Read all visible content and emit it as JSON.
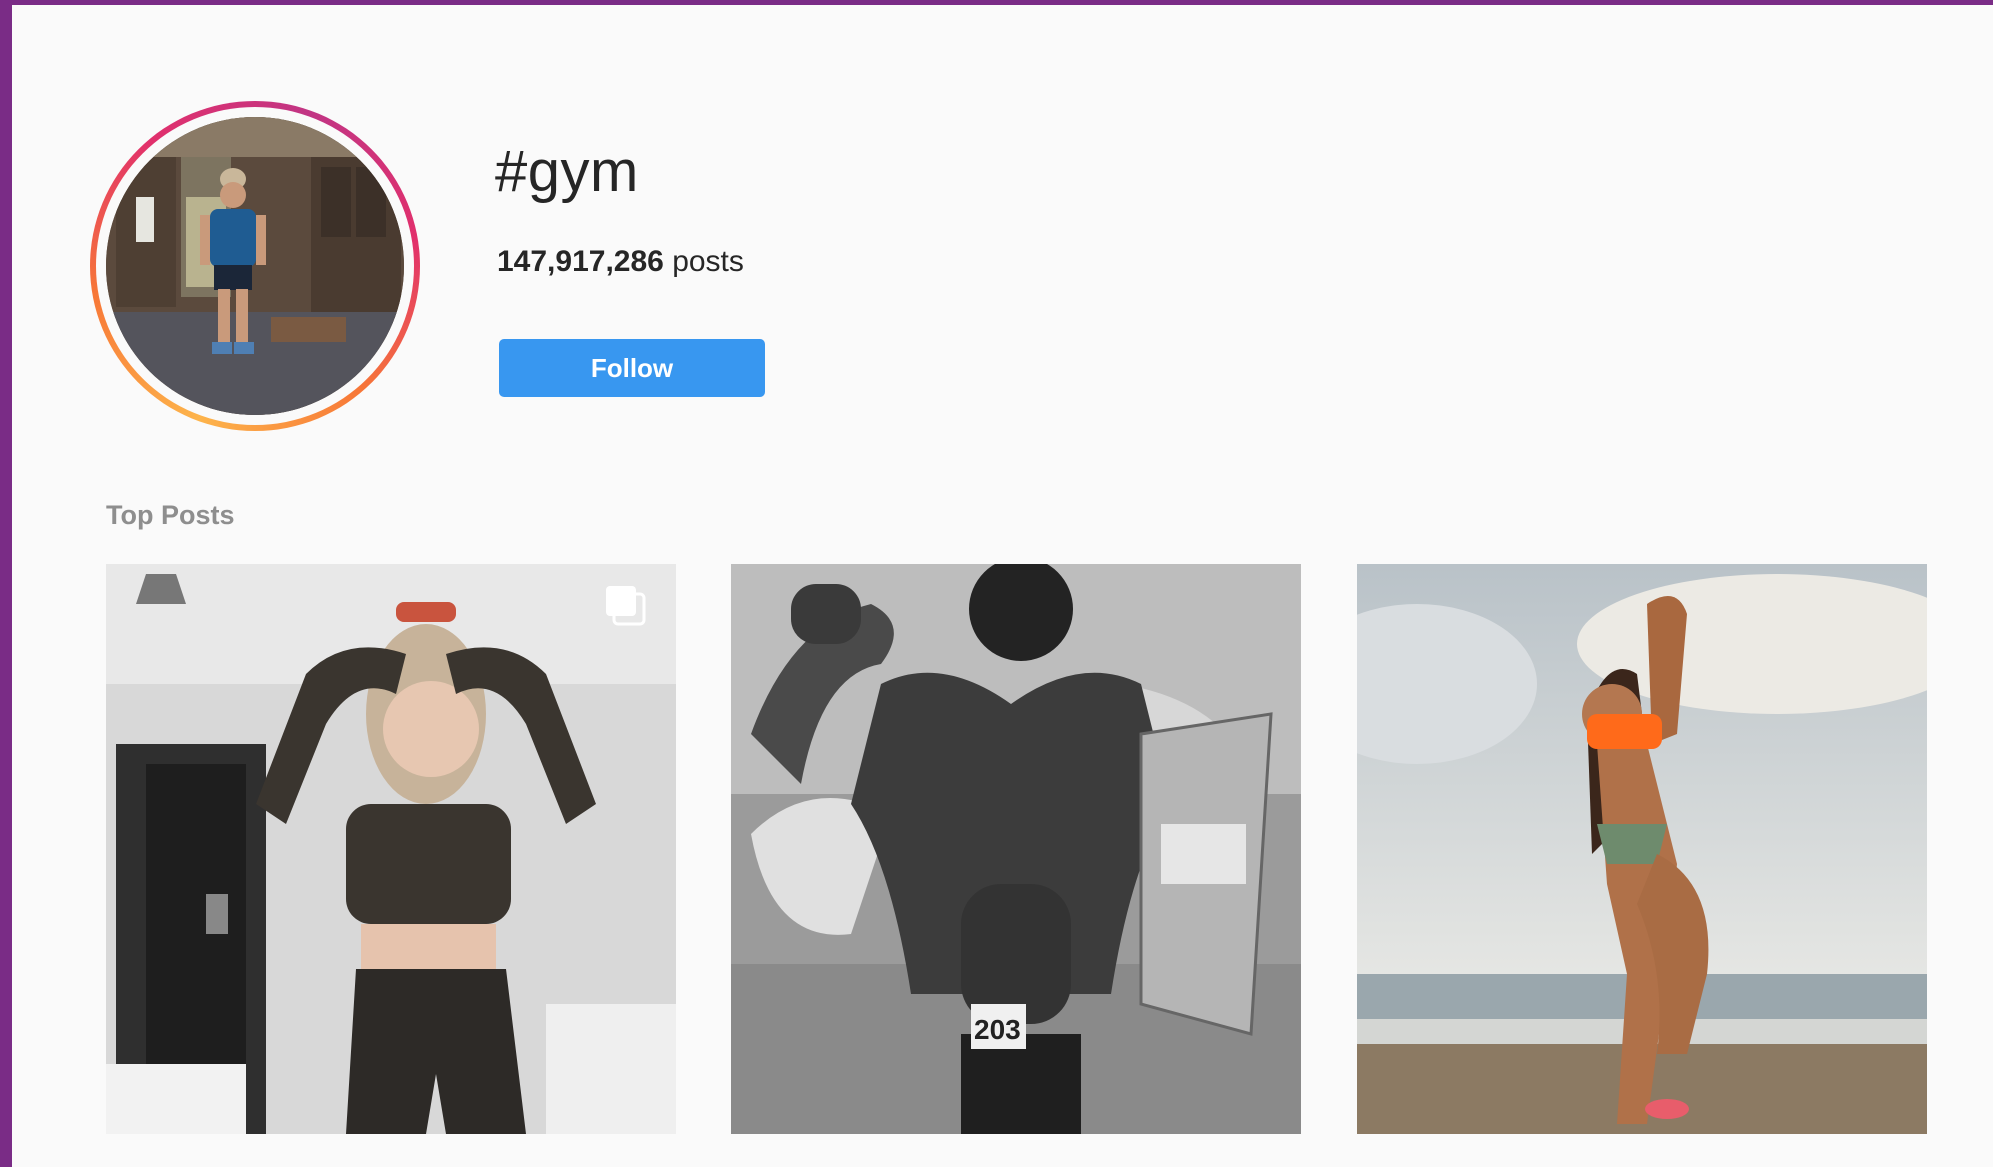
{
  "hashtag": {
    "title": "#gym",
    "post_count": "147,917,286",
    "post_suffix": "posts",
    "follow_label": "Follow"
  },
  "top_posts": {
    "label": "Top Posts",
    "items": [
      {
        "alt": "post-1"
      },
      {
        "alt": "post-2",
        "badge": "203"
      },
      {
        "alt": "post-3"
      }
    ]
  },
  "colors": {
    "accent": "#3897f0",
    "frame": "#7a2c86",
    "background": "#fafafa"
  },
  "icons": {
    "multi_image": "carousel-icon"
  }
}
